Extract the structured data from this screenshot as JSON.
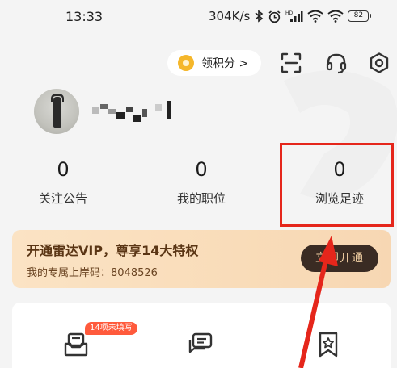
{
  "status_bar": {
    "time": "13:33",
    "network_speed": "304K/s",
    "battery": "82"
  },
  "top_actions": {
    "points_label": "领积分 >",
    "icons": [
      "coin-icon",
      "scan-icon",
      "headset-icon",
      "settings-icon"
    ]
  },
  "profile": {
    "avatar": "avatar-image",
    "name_obscured": true
  },
  "stats": [
    {
      "value": "0",
      "label": "关注公告"
    },
    {
      "value": "0",
      "label": "我的职位"
    },
    {
      "value": "0",
      "label": "浏览足迹"
    }
  ],
  "vip_banner": {
    "title": "开通雷达VIP，尊享14大特权",
    "subtitle": "我的专属上岸码：8048526",
    "button_label": "立即开通"
  },
  "bottom_card": {
    "tag": "14项未填写",
    "icons": [
      "resume-tray-icon",
      "chat-icon",
      "bookmark-star-icon"
    ]
  },
  "colors": {
    "highlight": "#e5261b",
    "vip_bg": "#f9dcb9",
    "vip_button": "#3a2b23",
    "coin": "#f5b72b",
    "tag": "#ff5a3c"
  }
}
